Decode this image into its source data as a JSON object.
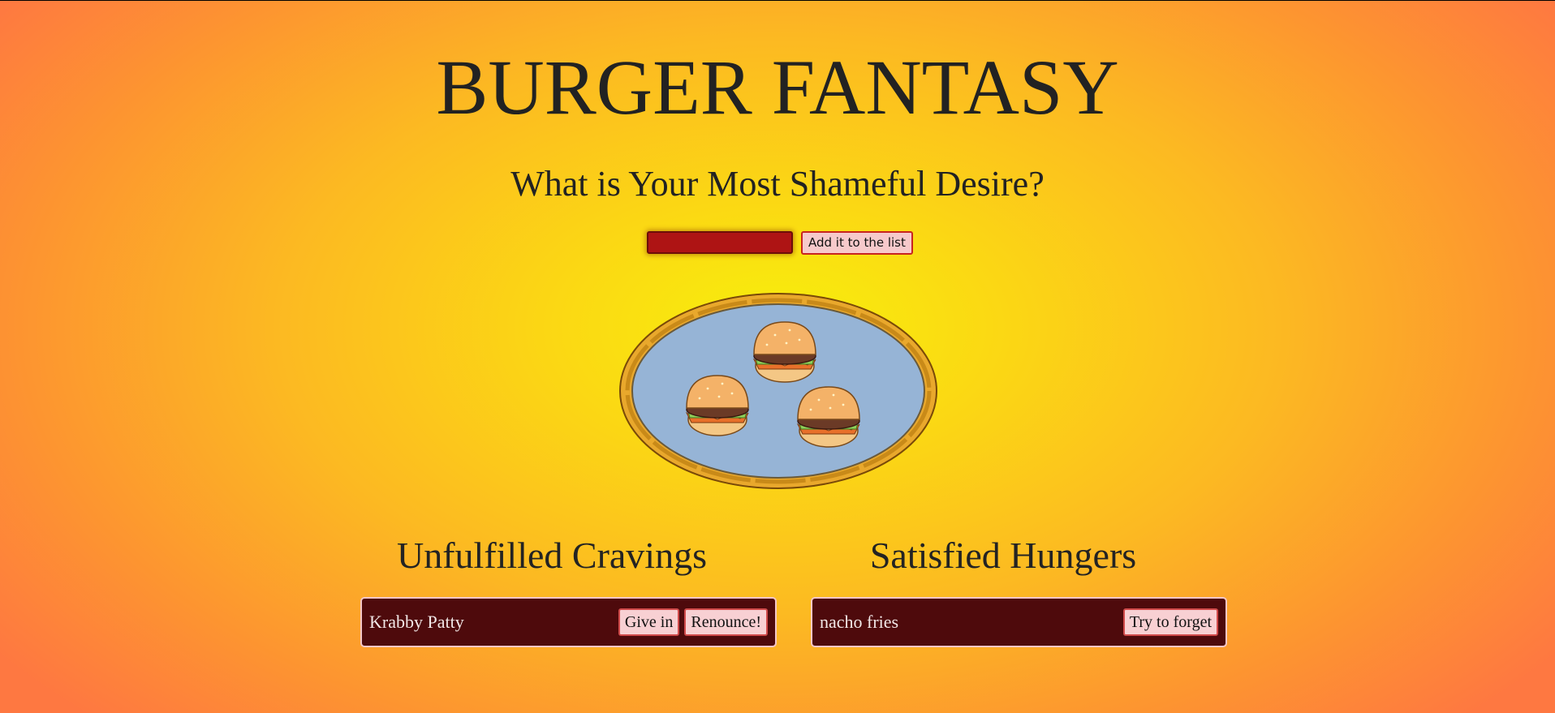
{
  "header": {
    "title": "BURGER FANTASY",
    "subtitle": "What is Your Most Shameful Desire?"
  },
  "form": {
    "input_value": "",
    "add_button_label": "Add it to the list"
  },
  "platter": {
    "description_icon": "burger-platter-illustration",
    "burger_count": 3
  },
  "cravings": {
    "heading": "Unfulfilled Cravings",
    "items": [
      {
        "name": "Krabby Patty",
        "give_in_label": "Give in",
        "renounce_label": "Renounce!"
      }
    ]
  },
  "satisfied": {
    "heading": "Satisfied Hungers",
    "items": [
      {
        "name": "nacho fries",
        "forget_label": "Try to forget"
      }
    ]
  },
  "colors": {
    "background_center": "#f7ef0c",
    "background_edge": "#fe7841",
    "card_background": "#4e0a0c",
    "input_background": "#ae1414",
    "button_background": "#f8d0d3",
    "platter_fill": "#96b4d6",
    "platter_rim": "#e9a82c"
  }
}
